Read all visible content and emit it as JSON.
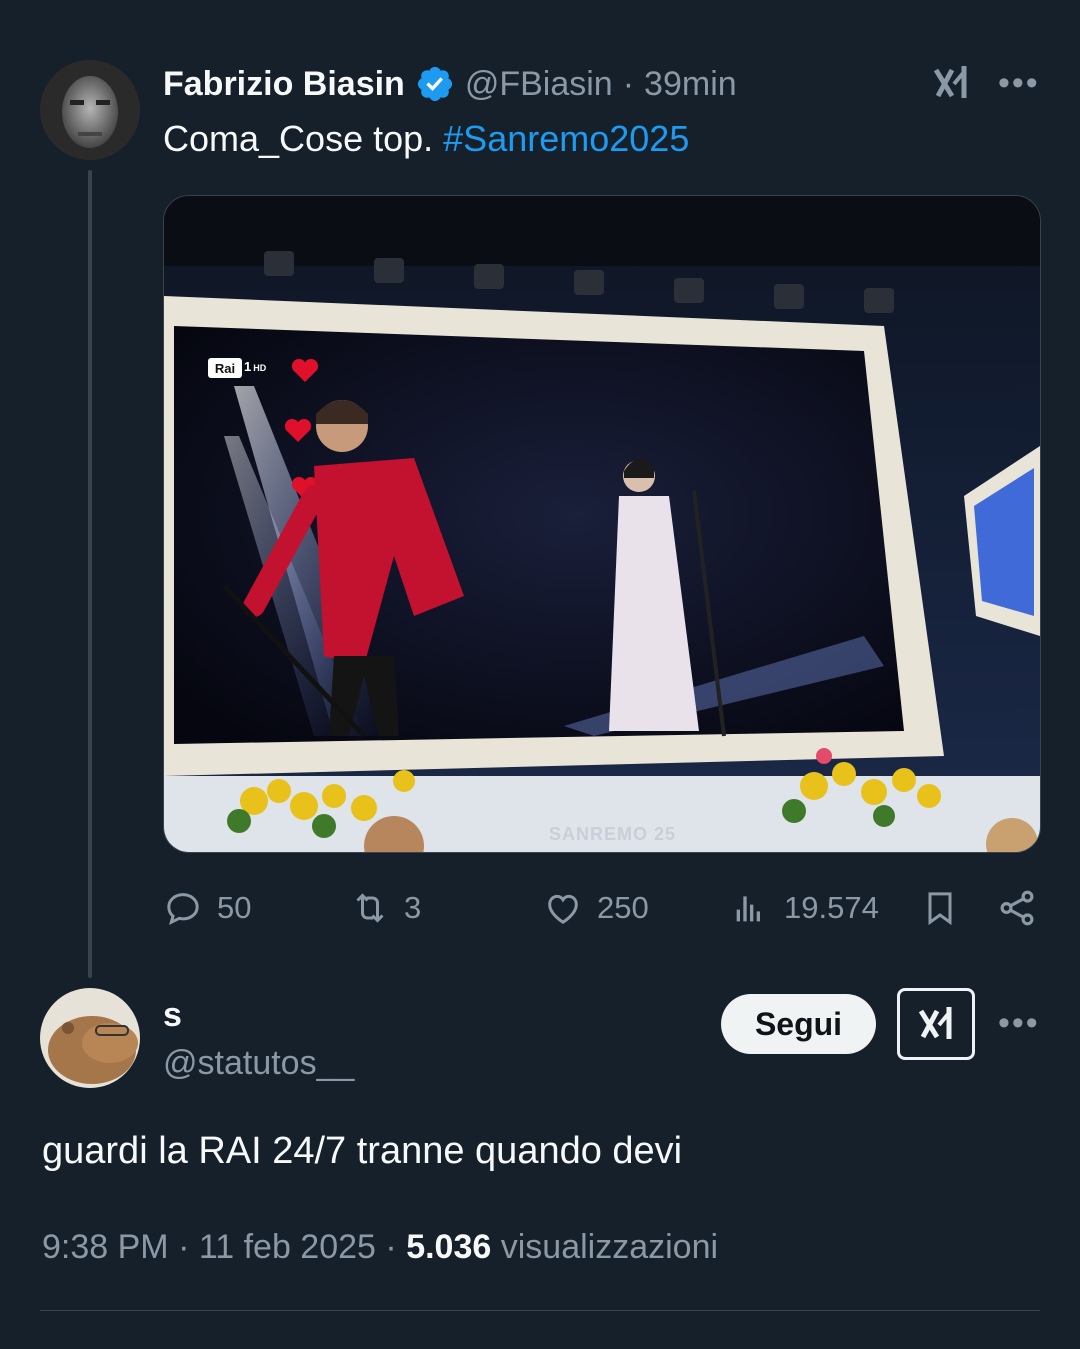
{
  "tweet": {
    "author_name": "Fabrizio Biasin",
    "author_handle": "@FBiasin",
    "separator": "·",
    "time_ago": "39min",
    "text_plain": "Coma_Cose top. ",
    "hashtag": "#Sanremo2025",
    "media": {
      "channel_logo": "Rai",
      "channel_number": "1",
      "channel_hd": "HD",
      "stage_text": "SANREMO 25"
    },
    "actions": {
      "replies": "50",
      "retweets": "3",
      "likes": "250",
      "views": "19.574"
    },
    "icons": [
      "verified-badge-icon",
      "grok-icon",
      "more-icon",
      "reply-icon",
      "retweet-icon",
      "like-icon",
      "views-icon",
      "bookmark-icon",
      "share-icon"
    ]
  },
  "reply": {
    "author_name": "s",
    "author_handle": "@statutos__",
    "follow_label": "Segui",
    "text": "guardi la RAI 24/7 tranne quando devi",
    "time": "9:38 PM",
    "sep1": "·",
    "date": "11 feb 2025",
    "sep2": "·",
    "views_count": "5.036",
    "views_label": "visualizzazioni"
  },
  "colors": {
    "background": "#15202b",
    "accent": "#1d9bf0",
    "muted": "#8b98a5"
  }
}
